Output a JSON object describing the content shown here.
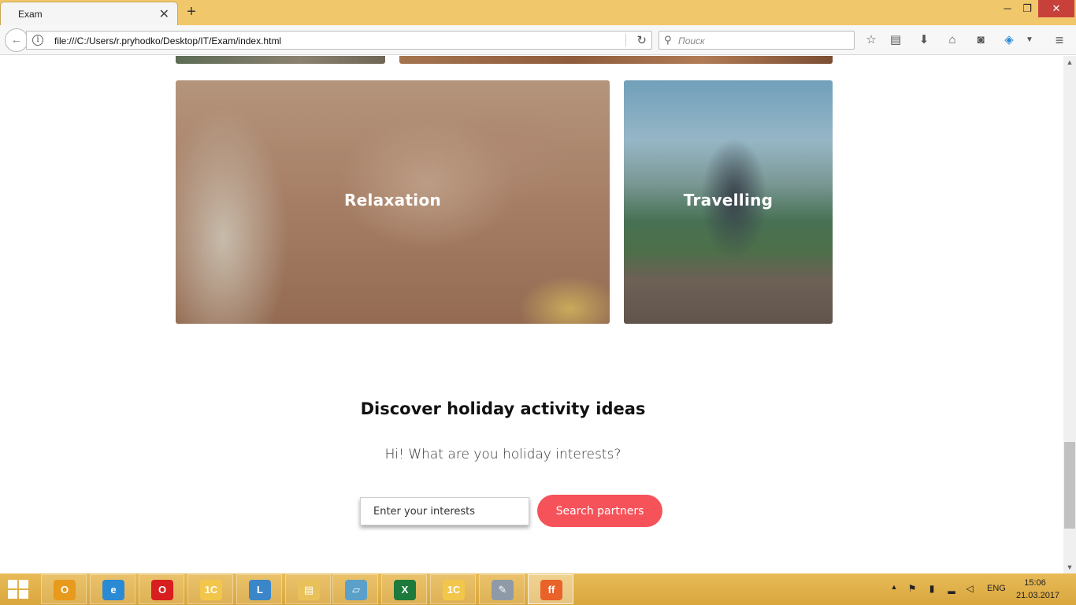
{
  "browser": {
    "tab_title": "Exam",
    "url": "file:///C:/Users/r.pryhodko/Desktop/IT/Exam/index.html",
    "search_placeholder": "Поиск"
  },
  "cards": [
    {
      "label": "Relaxation"
    },
    {
      "label": "Travelling"
    }
  ],
  "discover": {
    "title": "Discover holiday activity ideas",
    "subtitle": "Hi! What are you holiday interests?",
    "input_placeholder": "Enter your interests",
    "button_label": "Search partners"
  },
  "taskbar": {
    "apps": [
      {
        "name": "outlook",
        "glyph": "O",
        "color": "#e89a1c"
      },
      {
        "name": "internet-explorer",
        "glyph": "e",
        "color": "#2a8ad4"
      },
      {
        "name": "opera",
        "glyph": "O",
        "color": "#d81e1e"
      },
      {
        "name": "1c",
        "glyph": "1С",
        "color": "#f2c64a"
      },
      {
        "name": "remote-app",
        "glyph": "L",
        "color": "#3a86c8"
      },
      {
        "name": "file-explorer",
        "glyph": "▤",
        "color": "#e9c15a"
      },
      {
        "name": "notes-app",
        "glyph": "▱",
        "color": "#5aa0c8"
      },
      {
        "name": "excel",
        "glyph": "X",
        "color": "#1e7a3c"
      },
      {
        "name": "1c-second",
        "glyph": "1С",
        "color": "#f2c64a"
      },
      {
        "name": "paint",
        "glyph": "✎",
        "color": "#8e9aa8"
      },
      {
        "name": "firefox",
        "glyph": "ff",
        "color": "#e8622a"
      }
    ],
    "language": "ENG",
    "time": "15:06",
    "date": "21.03.2017"
  }
}
